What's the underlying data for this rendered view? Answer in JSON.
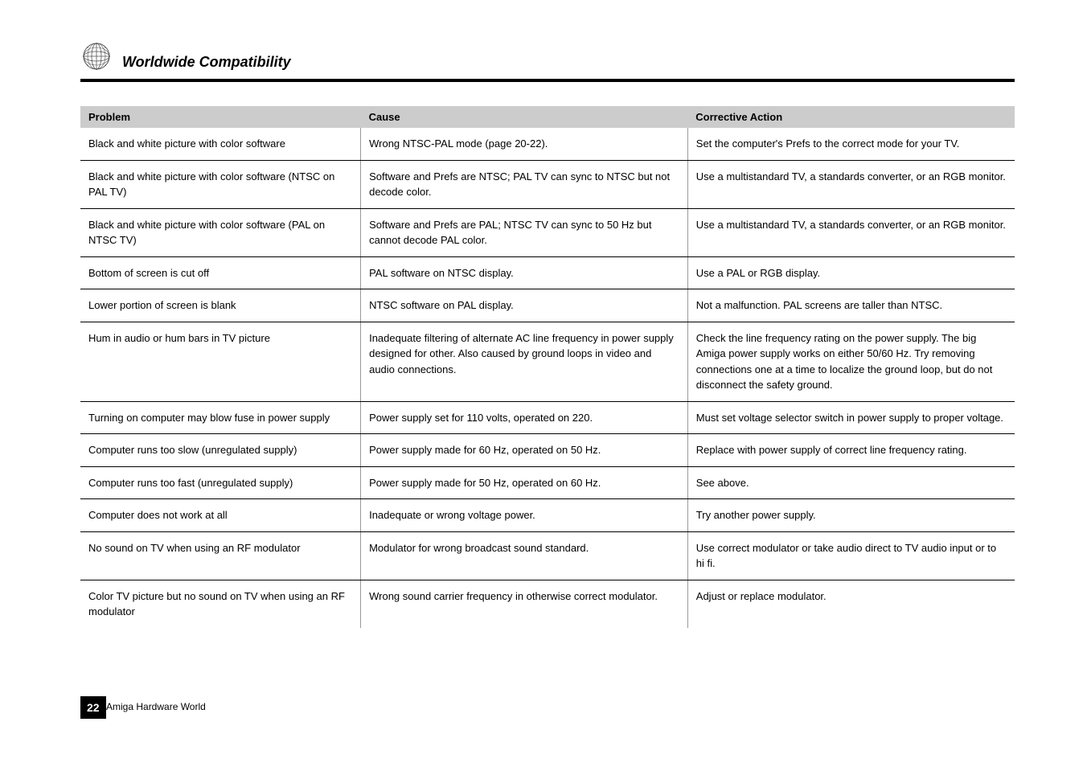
{
  "header": {
    "title": "Worldwide Compatibility"
  },
  "table": {
    "headers": [
      "Problem",
      "Cause",
      "Corrective Action"
    ],
    "rows": [
      {
        "problem": "Black and white picture with color software",
        "cause": "Wrong NTSC-PAL mode (page 20-22).",
        "action": "Set the computer's Prefs to the correct mode for your TV."
      },
      {
        "problem": "Black and white picture with color software (NTSC on PAL TV)",
        "cause": "Software and Prefs are NTSC; PAL TV can sync to NTSC but not decode color.",
        "action": "Use a multistandard TV, a standards converter, or an RGB monitor."
      },
      {
        "problem": "Black and white picture with color software (PAL on NTSC TV)",
        "cause": "Software and Prefs are PAL; NTSC TV can sync to 50 Hz but cannot decode PAL color.",
        "action": "Use a multistandard TV, a standards converter, or an RGB monitor."
      },
      {
        "problem": "Bottom of screen is cut off",
        "cause": "PAL software on NTSC display.",
        "action": "Use a PAL or RGB display."
      },
      {
        "problem": "Lower portion of screen is blank",
        "cause": "NTSC software on PAL display.",
        "action": "Not a malfunction. PAL screens are taller than NTSC."
      },
      {
        "problem": "Hum in audio or hum bars in TV picture",
        "cause": "Inadequate filtering of alternate AC line frequency in power supply designed for other. Also caused by ground loops in video and audio connections.",
        "action": "Check the line frequency rating on the power supply. The big Amiga power supply works on either 50/60 Hz. Try removing connections one at a time to localize the ground loop, but do not disconnect the safety ground."
      },
      {
        "problem": "Turning on computer may blow fuse in power supply",
        "cause": "Power supply set for 110 volts, operated on 220.",
        "action": "Must set voltage selector switch in power supply to proper voltage."
      },
      {
        "problem": "Computer runs too slow (unregulated supply)",
        "cause": "Power supply made for 60 Hz, operated on 50 Hz.",
        "action": "Replace with power supply of correct line frequency rating."
      },
      {
        "problem": "Computer runs too fast (unregulated supply)",
        "cause": "Power supply made for 50 Hz, operated on 60 Hz.",
        "action": "See above."
      },
      {
        "problem": "Computer does not work at all",
        "cause": "Inadequate or wrong voltage power.",
        "action": "Try another power supply."
      },
      {
        "problem": "No sound on TV when using an RF modulator",
        "cause": "Modulator for wrong broadcast sound standard.",
        "action": "Use correct modulator or take audio direct to TV audio input or to hi fi."
      },
      {
        "problem": "Color TV picture but no sound on TV when using an RF modulator",
        "cause": "Wrong sound carrier frequency in otherwise correct modulator.",
        "action": "Adjust or replace modulator."
      }
    ]
  },
  "footer": {
    "page_number": "22",
    "label": "Amiga Hardware World"
  }
}
